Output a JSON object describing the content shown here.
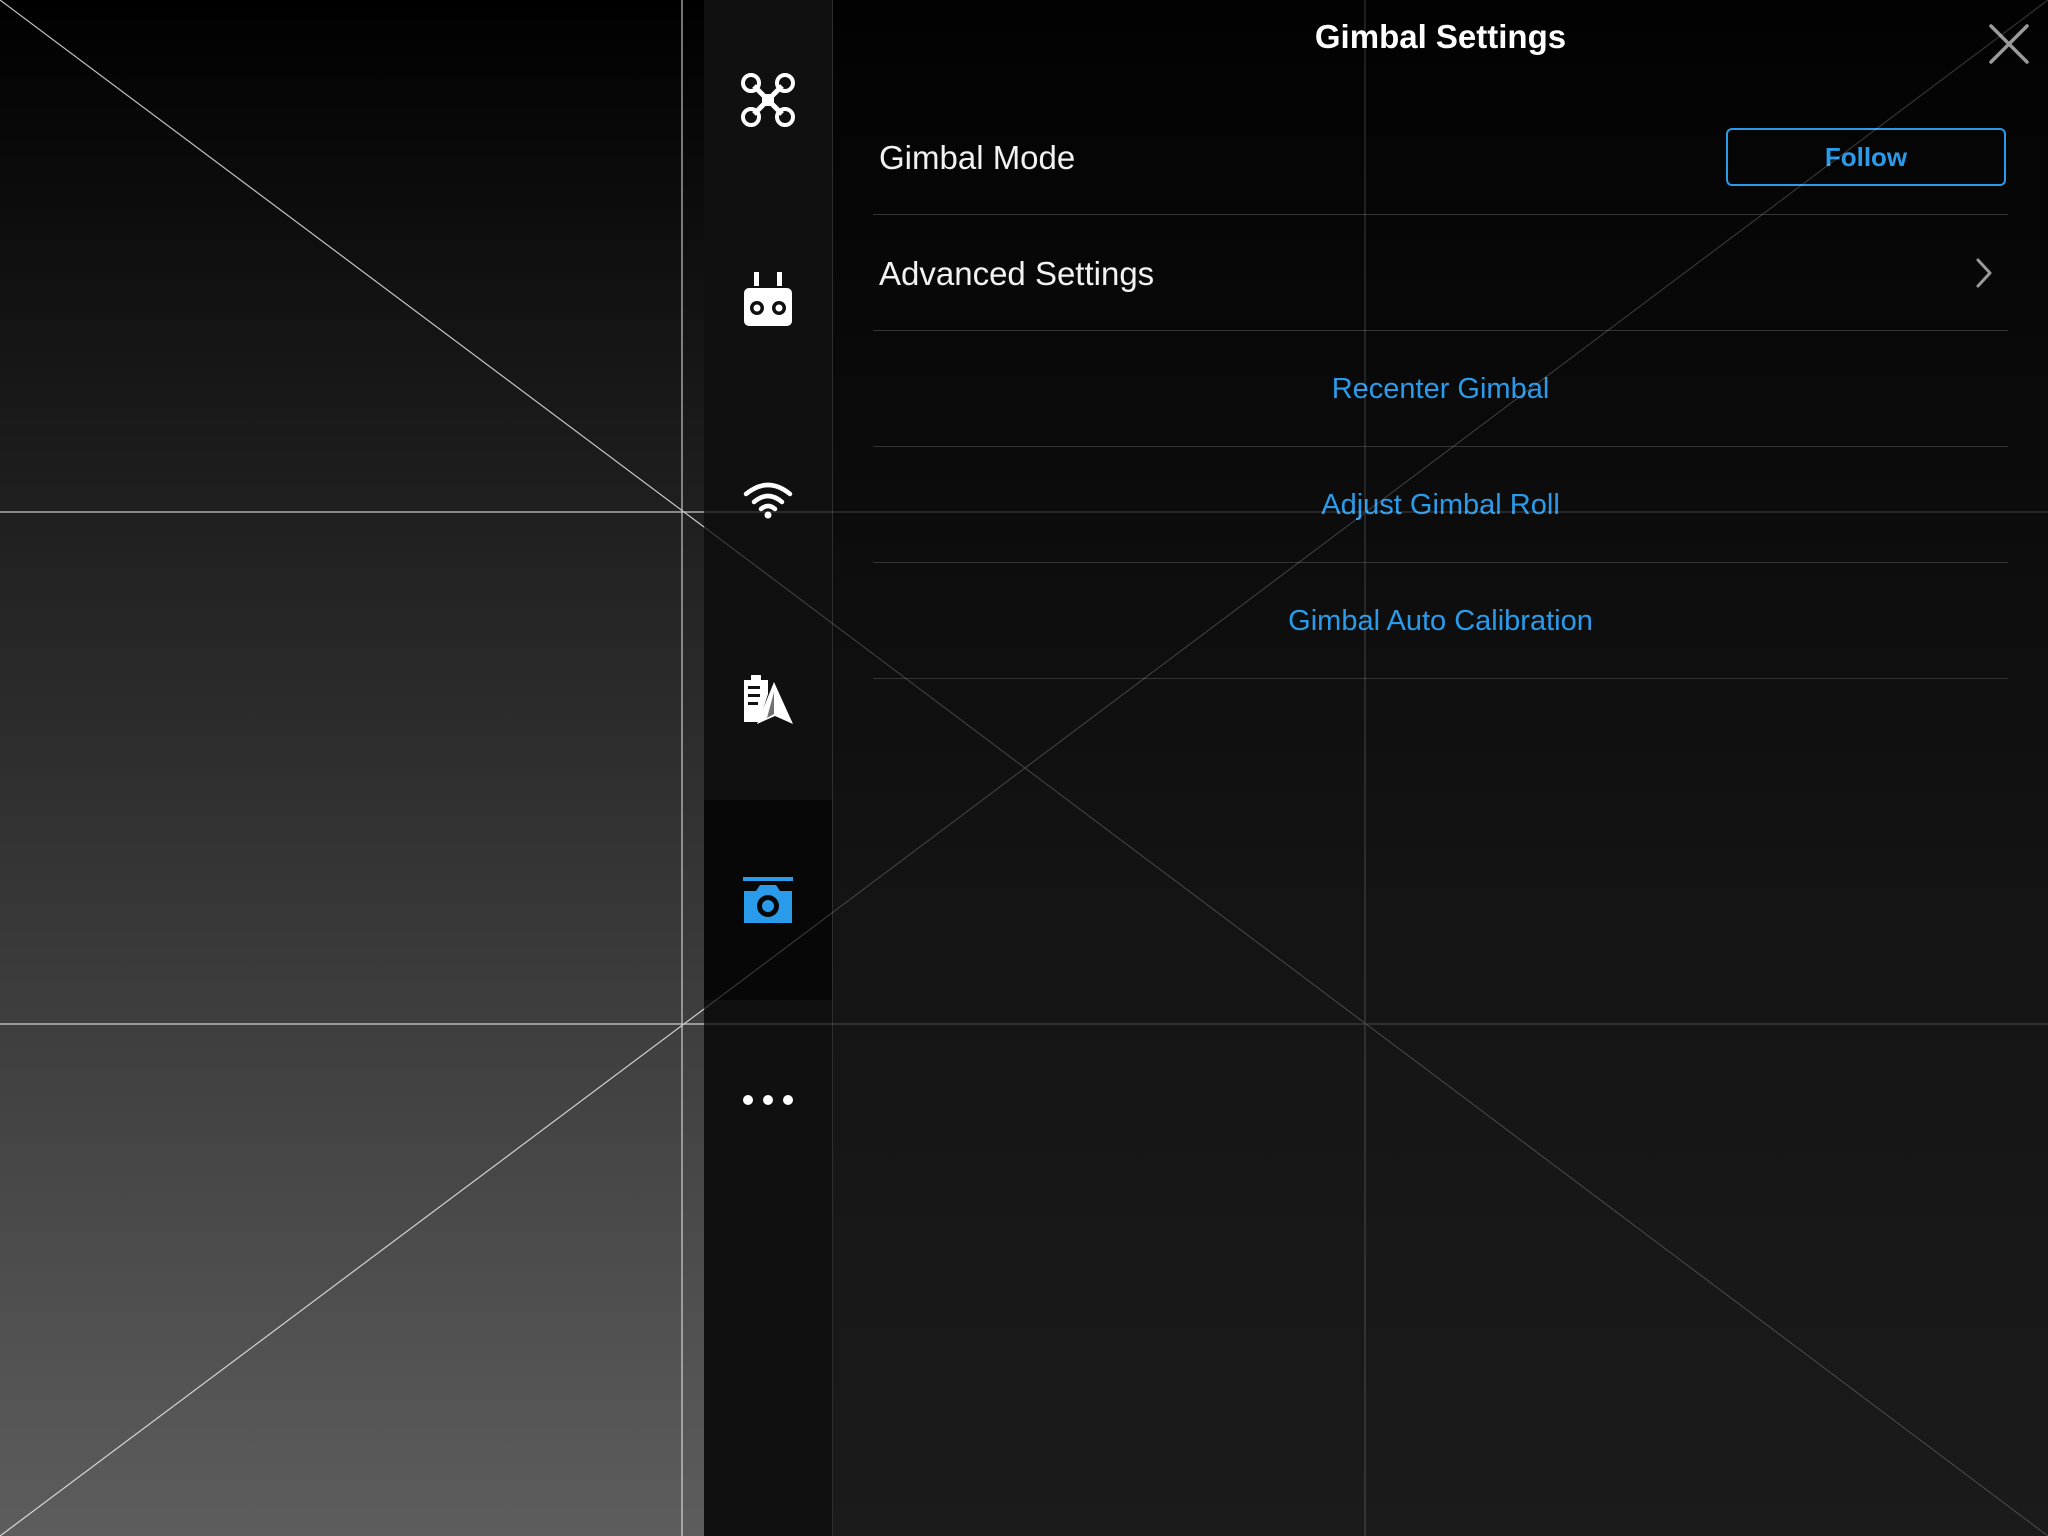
{
  "panel": {
    "title": "Gimbal Settings",
    "close_icon": "close-icon"
  },
  "tabs": [
    {
      "name": "aircraft",
      "icon": "drone-icon",
      "active": false
    },
    {
      "name": "remote-controller",
      "icon": "remote-controller-icon",
      "active": false
    },
    {
      "name": "transmission",
      "icon": "wifi-signal-icon",
      "active": false
    },
    {
      "name": "battery",
      "icon": "battery-navigation-icon",
      "active": false
    },
    {
      "name": "gimbal",
      "icon": "gimbal-camera-icon",
      "active": true
    },
    {
      "name": "more",
      "icon": "more-dots-icon",
      "active": false
    }
  ],
  "settings": {
    "gimbal_mode": {
      "label": "Gimbal Mode",
      "value": "Follow"
    },
    "advanced": {
      "label": "Advanced Settings",
      "icon": "chevron-right-icon"
    },
    "actions": [
      {
        "label": "Recenter Gimbal"
      },
      {
        "label": "Adjust Gimbal Roll"
      },
      {
        "label": "Gimbal Auto Calibration"
      }
    ]
  },
  "colors": {
    "accent": "#2a9bea",
    "text": "#f2f2f2",
    "panel_bg": "#0e0e0e",
    "divider": "#343434"
  }
}
